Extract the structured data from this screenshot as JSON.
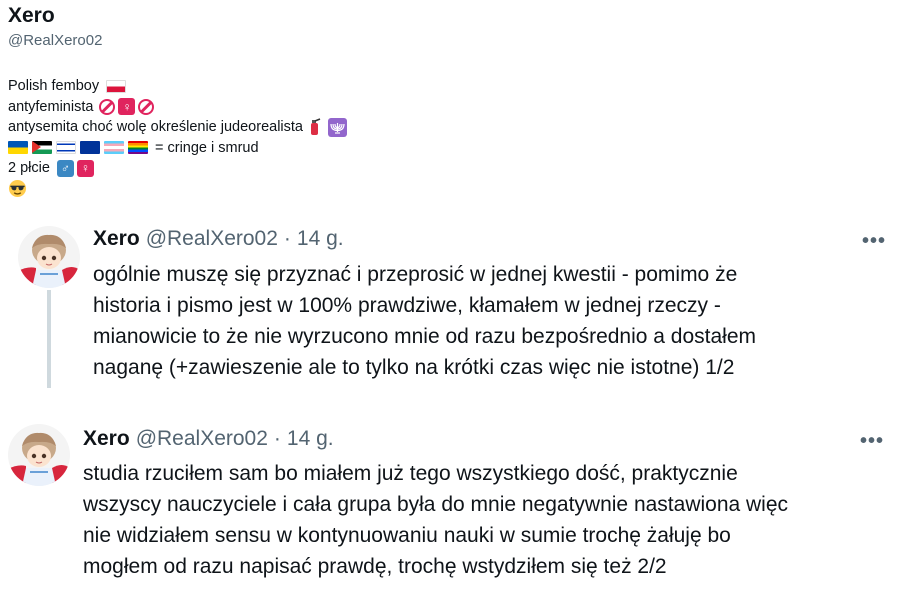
{
  "profile": {
    "name": "Xero",
    "handle": "@RealXero02",
    "bio": {
      "line1": "Polish femboy",
      "line2": "antyfeminista",
      "line3": "antysemita choć wolę określenie judeorealista",
      "line4": "= cringe i smrud",
      "line5": "2 płcie"
    },
    "icons": [
      "flag-poland-icon",
      "no-entry-icon",
      "woman-symbol-icon",
      "fire-extinguisher-icon",
      "menorah-icon",
      "flag-ukraine-icon",
      "flag-palestine-icon",
      "flag-israel-icon",
      "flag-eu-icon",
      "flag-trans-icon",
      "flag-rainbow-icon",
      "male-sign-icon",
      "female-sign-icon",
      "sunglasses-emoji-icon"
    ]
  },
  "tweets": [
    {
      "name": "Xero",
      "handle": "@RealXero02",
      "separator": "·",
      "time": "14 g.",
      "more": "•••",
      "text": "ogólnie muszę się przyznać i przeprosić w jednej kwestii - pomimo że\nhistoria  i pismo jest w 100% prawdziwe,  kłamałem  w jednej rzeczy -\nmianowicie  to że nie wyrzucono mnie  od razu bezpośrednio a dostałem\nnaganę (+zawieszenie ale to tylko na krótki czas więc nie istotne) 1/2"
    },
    {
      "name": "Xero",
      "handle": "@RealXero02",
      "separator": "·",
      "time": "14 g.",
      "more": "•••",
      "text": "studia rzuciłem sam bo miałem już tego wszystkiego dość, praktycznie\nwszyscy nauczyciele i cała grupa była do mnie negatywnie nastawiona więc\nnie widziałem sensu w kontynuowaniu nauki w sumie trochę żałuję bo\nmogłem od razu napisać prawdę, trochę wstydziłem się też 2/2"
    }
  ]
}
